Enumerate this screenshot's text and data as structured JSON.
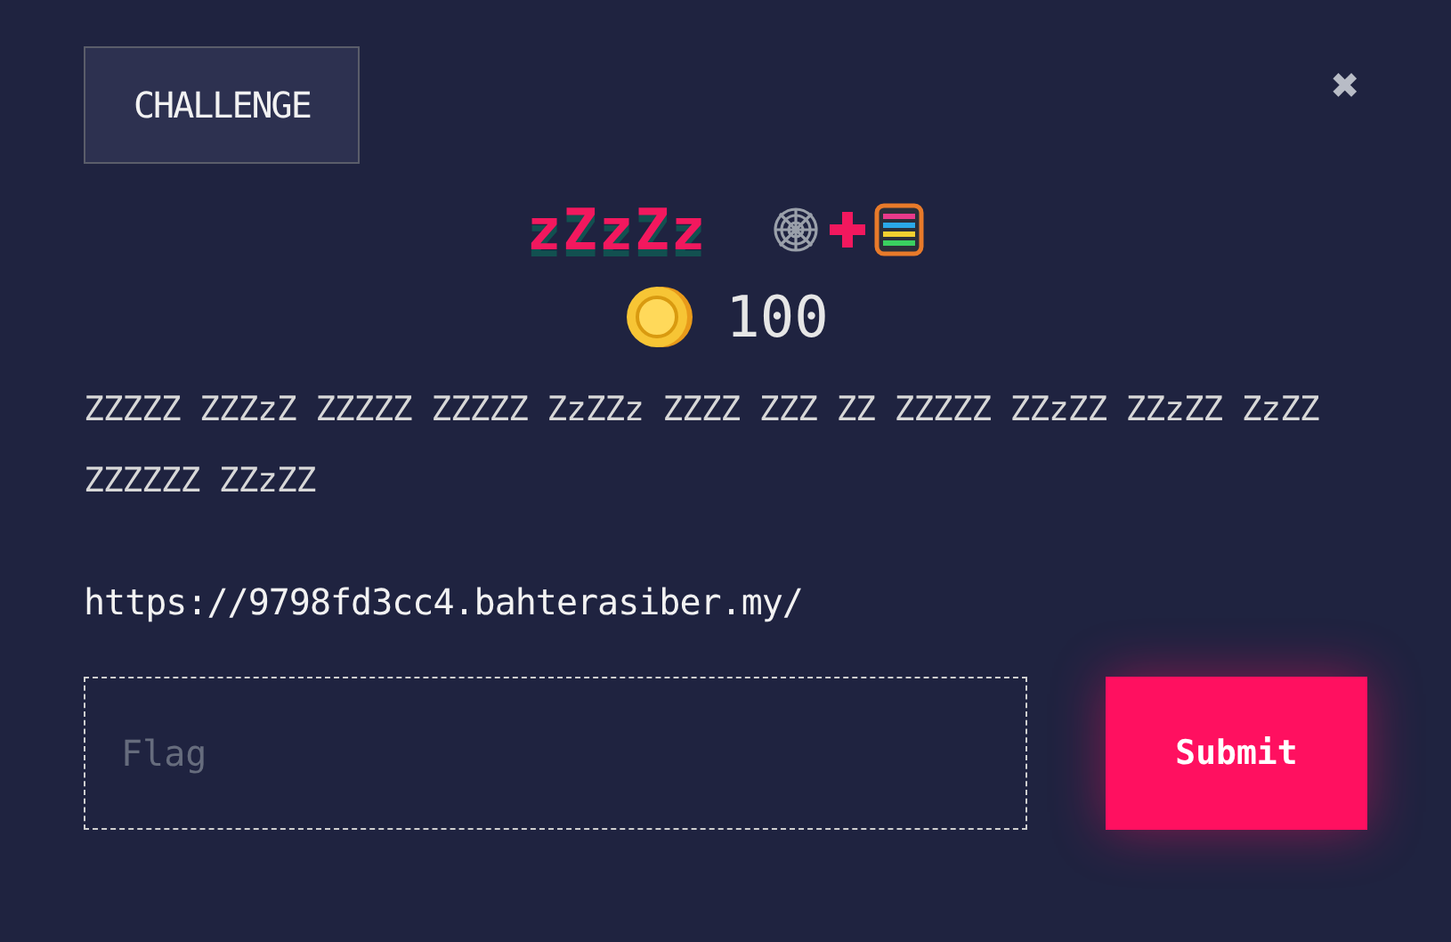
{
  "tab": {
    "label": "CHALLENGE"
  },
  "close": {
    "label": "✖"
  },
  "title": "zZzZz",
  "points": "100",
  "description": "ZZZZZ ZZZzZ ZZZZZ ZZZZZ ZzZZz ZZZZ ZZZ ZZ ZZZZZ ZZzZZ ZZzZZ ZzZZ ZZZZZZ ZZzZZ",
  "link": "https://9798fd3cc4.bahterasiber.my/",
  "flag_field": {
    "placeholder": "Flag"
  },
  "submit": {
    "label": "Submit"
  }
}
